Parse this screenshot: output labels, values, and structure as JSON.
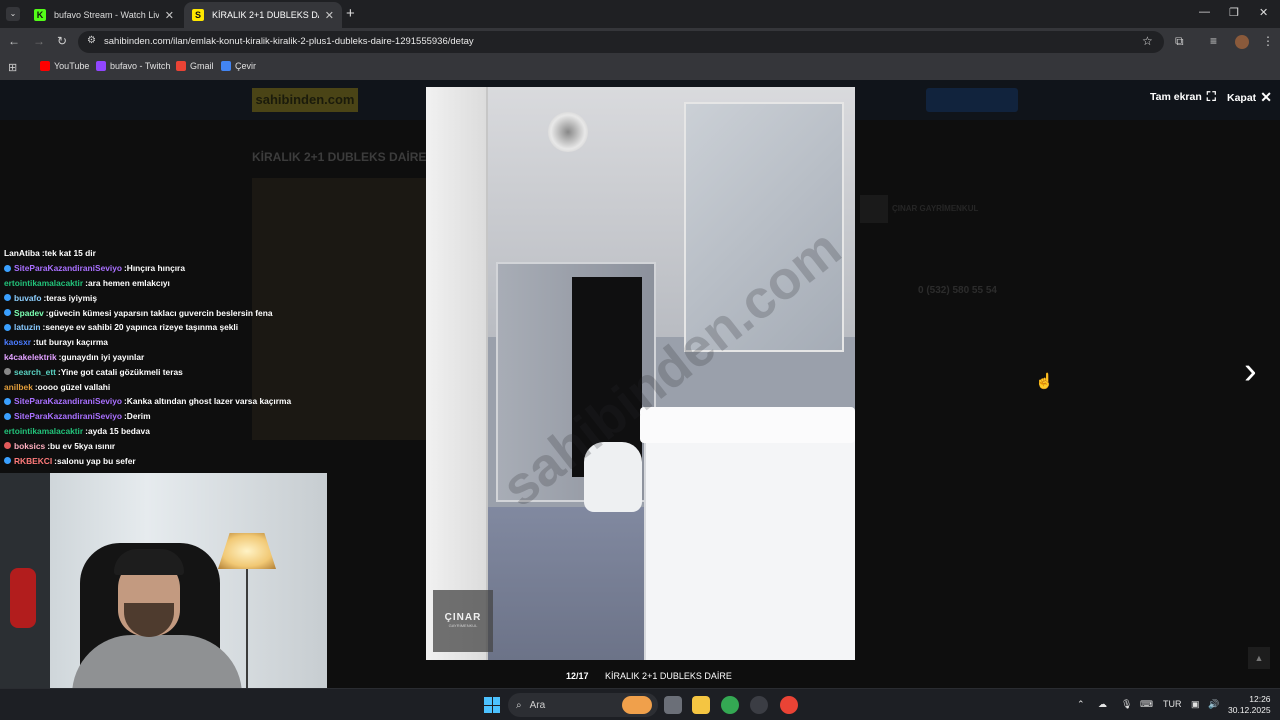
{
  "browser": {
    "tabs": [
      {
        "title": "bufavo Stream - Watch Live on",
        "favicon": "K",
        "favicon_color": "#53fc18",
        "active": false
      },
      {
        "title": "KİRALIK 2+1 DUBLEKS DAİRE -",
        "favicon": "S",
        "favicon_color": "#ffe800",
        "active": true
      }
    ],
    "url": "sahibinden.com/ilan/emlak-konut-kiralik-kiralik-2-plus1-dubleks-daire-1291555936/detay",
    "bookmarks": [
      {
        "label": "YouTube",
        "icon": "youtube-icon",
        "color": "#ff0000"
      },
      {
        "label": "bufavo - Twitch",
        "icon": "twitch-icon",
        "color": "#9146ff"
      },
      {
        "label": "Gmail",
        "icon": "gmail-icon",
        "color": "#ea4335"
      },
      {
        "label": "Çevir",
        "icon": "translate-icon",
        "color": "#4285f4"
      }
    ]
  },
  "page": {
    "site_logo": "sahibinden.com",
    "listing_title": "KİRALIK 2+1 DUBLEKS DAİRE",
    "seller_name": "ÇINAR GAYRİMENKUL",
    "seller_phone": "0 (532) 580 55 54"
  },
  "chat": [
    {
      "user": "LanAtiba",
      "user_color": "#ffffff",
      "message": "tek kat 15 dir",
      "badge": ""
    },
    {
      "user": "SiteParaKazandiraniSeviyo",
      "user_color": "#a970ff",
      "message": "Hınçıra hınçıra",
      "badge": "#3aa0ff"
    },
    {
      "user": "ertointikamalacaktir",
      "user_color": "#22c37a",
      "message": "ara hemen emlakcıyı",
      "badge": ""
    },
    {
      "user": "buvafo",
      "user_color": "#8ed0ff",
      "message": "teras iyiymiş",
      "badge": "#3aa0ff"
    },
    {
      "user": "Spadev",
      "user_color": "#7cffb2",
      "message": "güvecin kümesi yaparsın taklacı guvercin beslersin fena",
      "badge": "#3aa0ff"
    },
    {
      "user": "latuzin",
      "user_color": "#88c9ff",
      "message": "seneye ev sahibi 20 yapınca rizeye taşınma şekli",
      "badge": "#3aa0ff"
    },
    {
      "user": "kaosxr",
      "user_color": "#4a7bff",
      "message": "tut burayı kaçırma",
      "badge": ""
    },
    {
      "user": "k4cakelektrik",
      "user_color": "#e0a0ff",
      "message": "gunaydın iyi yayınlar",
      "badge": ""
    },
    {
      "user": "search_ett",
      "user_color": "#5ad1c1",
      "message": "Yine got catali gözükmeli teras",
      "badge": "#888888"
    },
    {
      "user": "anilbek",
      "user_color": "#e09c3a",
      "message": "oooo güzel vallahi",
      "badge": ""
    },
    {
      "user": "SiteParaKazandiraniSeviyo",
      "user_color": "#a970ff",
      "message": "Kanka altından ghost lazer varsa kaçırma",
      "badge": "#3aa0ff"
    },
    {
      "user": "SiteParaKazandiraniSeviyo",
      "user_color": "#a970ff",
      "message": "Derim",
      "badge": "#3aa0ff"
    },
    {
      "user": "ertointikamalacaktir",
      "user_color": "#22c37a",
      "message": "ayda 15 bedava",
      "badge": ""
    },
    {
      "user": "boksics",
      "user_color": "#ffb0c0",
      "message": "bu ev 5kya ısınır",
      "badge": "#e35b5b"
    },
    {
      "user": "RKBEKCI",
      "user_color": "#ff7a7a",
      "message": "salonu yap bu sefer",
      "badge": "#3aa0ff"
    }
  ],
  "lightbox": {
    "fullscreen_label": "Tam ekran",
    "close_label": "Kapat",
    "counter": "12/17",
    "caption": "KİRALIK 2+1 DUBLEKS DAİRE",
    "watermark": "sahibinden.com",
    "agency_logo_text": "ÇINAR",
    "agency_logo_sub": "GAYRİMENKUL"
  },
  "taskbar": {
    "search_placeholder": "Ara",
    "language": "TUR",
    "time": "12:26",
    "date": "30.12.2025"
  }
}
